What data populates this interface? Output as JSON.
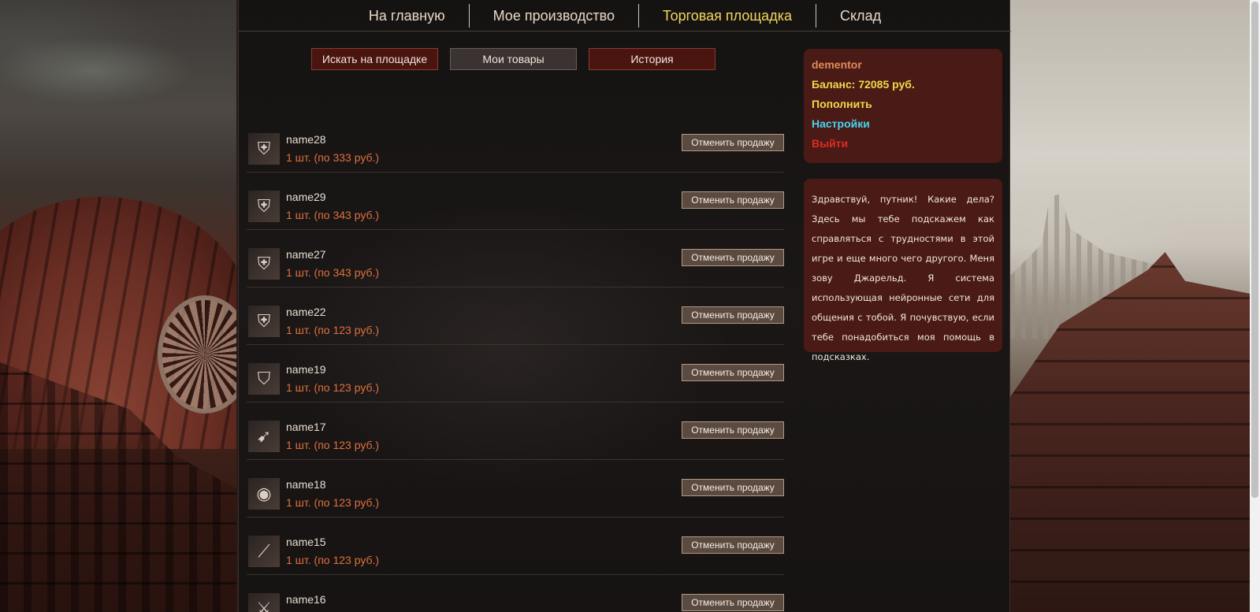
{
  "nav": [
    {
      "label": "На главную",
      "active": false
    },
    {
      "label": "Мое производство",
      "active": false
    },
    {
      "label": "Торговая площадка",
      "active": true
    },
    {
      "label": "Склад",
      "active": false
    }
  ],
  "tabs": [
    {
      "label": "Искать на площадке",
      "selected": false
    },
    {
      "label": "Мои товары",
      "selected": true
    },
    {
      "label": "История",
      "selected": false
    }
  ],
  "items": [
    {
      "name": "name28",
      "price": "1 шт. (по 333 руб.)",
      "icon": "leg-armor-icon",
      "action": "Отменить продажу"
    },
    {
      "name": "name29",
      "price": "1 шт. (по 343 руб.)",
      "icon": "pants-icon",
      "action": "Отменить продажу"
    },
    {
      "name": "name27",
      "price": "1 шт. (по 343 руб.)",
      "icon": "chest-armor-icon",
      "action": "Отменить продажу"
    },
    {
      "name": "name22",
      "price": "1 шт. (по 123 руб.)",
      "icon": "shirt-icon",
      "action": "Отменить продажу"
    },
    {
      "name": "name19",
      "price": "1 шт. (по 123 руб.)",
      "icon": "shield-icon",
      "action": "Отменить продажу"
    },
    {
      "name": "name17",
      "price": "1 шт. (по 123 руб.)",
      "icon": "quiver-icon",
      "action": "Отменить продажу"
    },
    {
      "name": "name18",
      "price": "1 шт. (по 123 руб.)",
      "icon": "round-shield-icon",
      "action": "Отменить продажу"
    },
    {
      "name": "name15",
      "price": "1 шт. (по 123 руб.)",
      "icon": "spear-icon",
      "action": "Отменить продажу"
    },
    {
      "name": "name16",
      "price": "",
      "icon": "sword-icon",
      "action": "Отменить продажу"
    }
  ],
  "user": {
    "name": "dementor",
    "balance": "Баланс: 72085 руб.",
    "topup": "Пополнить",
    "settings": "Настройки",
    "logout": "Выйти"
  },
  "assistant_message": "Здравствуй, путник! Какие дела? Здесь мы тебе подскажем как справляться с трудностями в этой игре и еще много чего другого. Меня зову Джарельд. Я система использующая нейронные сети для общения с тобой. Я почувствую, если тебе понадобиться моя помощь в подсказках.",
  "colors": {
    "accent_active_nav": "#f3d75c",
    "price": "#e0703e",
    "panel_red": "#4a1a16",
    "settings_link": "#45d4f0",
    "logout_link": "#e12b22"
  }
}
